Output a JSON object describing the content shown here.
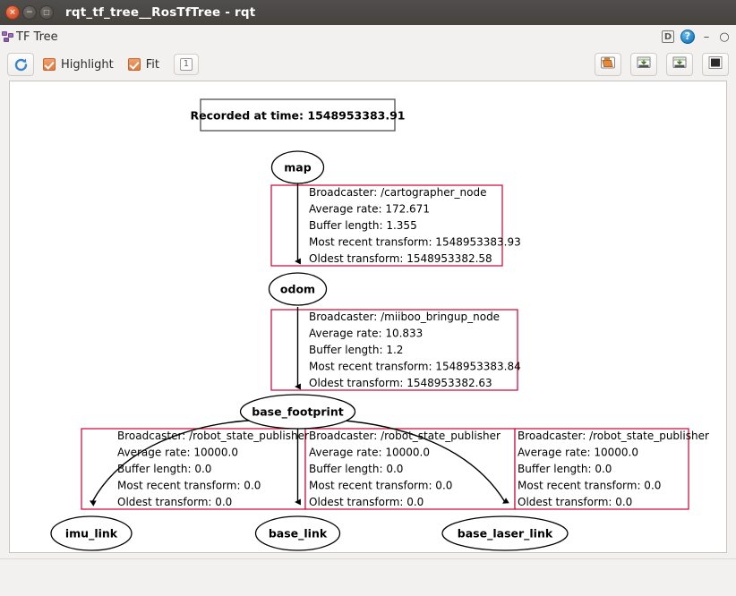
{
  "window": {
    "title": "rqt_tf_tree__RosTfTree - rqt",
    "buttons": {
      "close": "×",
      "minimize": "−",
      "maximize": "□"
    }
  },
  "panel": {
    "title": "TF Tree",
    "icon": "tf-tree-icon",
    "controls": {
      "dock": "D",
      "help": "?",
      "minimize": "–",
      "close": "○"
    }
  },
  "toolbar": {
    "refresh_label": "refresh-icon",
    "highlight_label": "Highlight",
    "highlight_checked": true,
    "fit_label": "Fit",
    "fit_checked": true,
    "depth_value": "1",
    "right_buttons": [
      {
        "name": "load-dot-button",
        "icon": "open-folder-icon"
      },
      {
        "name": "save-dot-button",
        "icon": "save-dot-icon"
      },
      {
        "name": "save-image-button",
        "icon": "save-image-icon"
      },
      {
        "name": "fit-in-view-button",
        "icon": "dark-square-icon"
      }
    ]
  },
  "graph": {
    "timestamp_box": "Recorded at time: 1548953383.91",
    "nodes": [
      {
        "id": "map",
        "label": "map"
      },
      {
        "id": "odom",
        "label": "odom"
      },
      {
        "id": "base_footprint",
        "label": "base_footprint"
      },
      {
        "id": "imu_link",
        "label": "imu_link"
      },
      {
        "id": "base_link",
        "label": "base_link"
      },
      {
        "id": "base_laser_link",
        "label": "base_laser_link"
      }
    ],
    "edges": [
      {
        "from": "map",
        "to": "odom",
        "lines": [
          "Broadcaster: /cartographer_node",
          "Average rate: 172.671",
          "Buffer length: 1.355",
          "Most recent transform: 1548953383.93",
          "Oldest transform: 1548953382.58"
        ]
      },
      {
        "from": "odom",
        "to": "base_footprint",
        "lines": [
          "Broadcaster: /miiboo_bringup_node",
          "Average rate: 10.833",
          "Buffer length: 1.2",
          "Most recent transform: 1548953383.84",
          "Oldest transform: 1548953382.63"
        ]
      },
      {
        "from": "base_footprint",
        "to": "imu_link",
        "lines": [
          "Broadcaster: /robot_state_publisher",
          "Average rate: 10000.0",
          "Buffer length: 0.0",
          "Most recent transform: 0.0",
          "Oldest transform: 0.0"
        ]
      },
      {
        "from": "base_footprint",
        "to": "base_link",
        "lines": [
          "Broadcaster: /robot_state_publisher",
          "Average rate: 10000.0",
          "Buffer length: 0.0",
          "Most recent transform: 0.0",
          "Oldest transform: 0.0"
        ]
      },
      {
        "from": "base_footprint",
        "to": "base_laser_link",
        "lines": [
          "Broadcaster: /robot_state_publisher",
          "Average rate: 10000.0",
          "Buffer length: 0.0",
          "Most recent transform: 0.0",
          "Oldest transform: 0.0"
        ]
      }
    ]
  },
  "colors": {
    "edge_box_border": "#cc0033",
    "node_stroke": "#000000",
    "titlebar": "#4a4744",
    "accent_orange": "#e07a3c"
  }
}
